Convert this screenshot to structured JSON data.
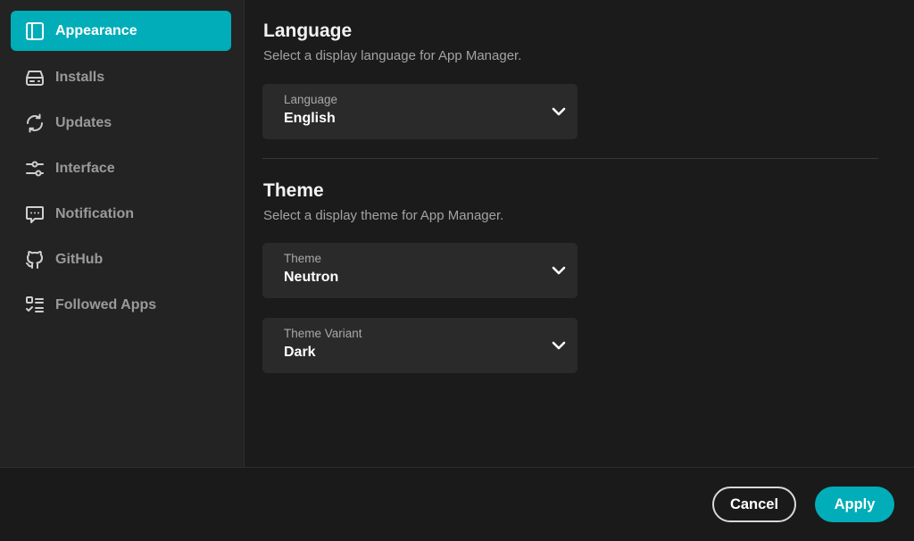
{
  "sidebar": {
    "items": [
      {
        "label": "Appearance",
        "icon": "appearance-icon",
        "active": true
      },
      {
        "label": "Installs",
        "icon": "drive-icon",
        "active": false
      },
      {
        "label": "Updates",
        "icon": "refresh-icon",
        "active": false
      },
      {
        "label": "Interface",
        "icon": "sliders-icon",
        "active": false
      },
      {
        "label": "Notification",
        "icon": "message-icon",
        "active": false
      },
      {
        "label": "GitHub",
        "icon": "github-icon",
        "active": false
      },
      {
        "label": "Followed Apps",
        "icon": "checklist-icon",
        "active": false
      }
    ]
  },
  "language": {
    "title": "Language",
    "description": "Select a display language for App Manager.",
    "select": {
      "caption": "Language",
      "value": "English"
    }
  },
  "theme": {
    "title": "Theme",
    "description": "Select a display theme for App Manager.",
    "theme_select": {
      "caption": "Theme",
      "value": "Neutron"
    },
    "variant_select": {
      "caption": "Theme Variant",
      "value": "Dark"
    }
  },
  "footer": {
    "cancel_label": "Cancel",
    "apply_label": "Apply"
  },
  "colors": {
    "accent": "#00adb8",
    "background": "#1b1b1b",
    "sidebar": "#232323"
  }
}
